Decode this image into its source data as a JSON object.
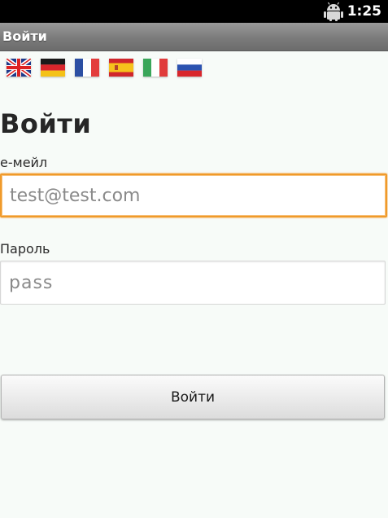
{
  "status_bar": {
    "time": "1:25",
    "icons": [
      "android-icon"
    ]
  },
  "title_bar": {
    "title": "Войти"
  },
  "languages": [
    {
      "code": "en",
      "icon": "uk-flag-icon"
    },
    {
      "code": "de",
      "icon": "germany-flag-icon"
    },
    {
      "code": "fr",
      "icon": "france-flag-icon"
    },
    {
      "code": "es",
      "icon": "spain-flag-icon"
    },
    {
      "code": "it",
      "icon": "italy-flag-icon"
    },
    {
      "code": "ru",
      "icon": "russia-flag-icon"
    }
  ],
  "form": {
    "heading": "Войти",
    "email_label": "е-мейл",
    "email_placeholder": "test@test.com",
    "email_value": "",
    "password_label": "Пароль",
    "password_placeholder": "pass",
    "password_value": "",
    "submit_label": "Войти"
  },
  "colors": {
    "background": "#f7fbf8",
    "focus_border": "#f09a2a",
    "title_bar": "#7b7b7b",
    "status_bar": "#000000"
  }
}
